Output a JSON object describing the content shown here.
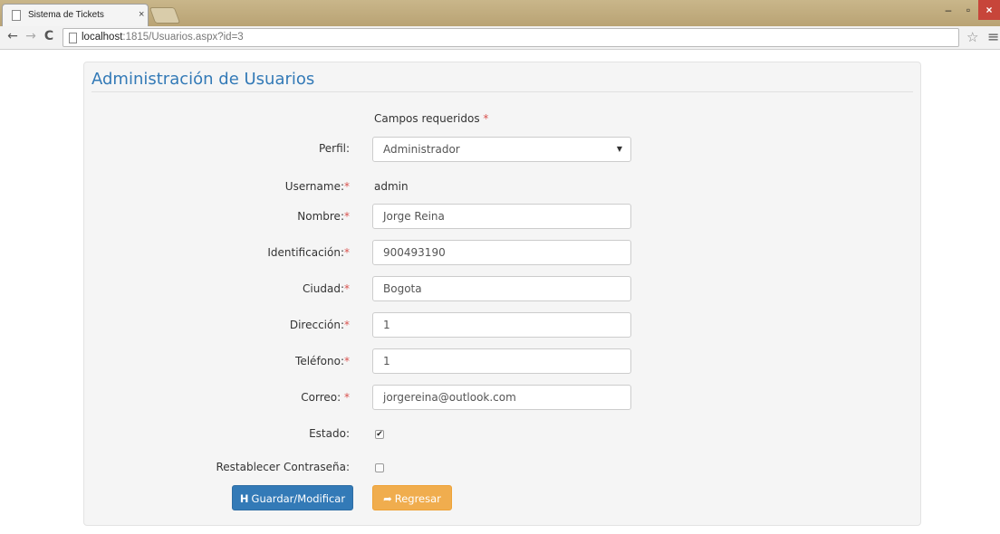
{
  "browser": {
    "tab_title": "Sistema de Tickets",
    "tab_close": "×",
    "url_host": "localhost",
    "url_path": ":1815/Usuarios.aspx?id=3",
    "minimize": "–",
    "maximize": "▫",
    "close": "×",
    "back": "←",
    "forward": "→",
    "reload": "C",
    "bookmark": "☆",
    "menu": "≡"
  },
  "page": {
    "title": "Administración de Usuarios",
    "required_text": "Campos requeridos",
    "required_star": "*"
  },
  "form": {
    "perfil": {
      "label": "Perfil:",
      "value": "Administrador"
    },
    "username": {
      "label": "Username:",
      "star": "*",
      "value": "admin"
    },
    "nombre": {
      "label": "Nombre:",
      "star": "*",
      "value": "Jorge Reina"
    },
    "identificacion": {
      "label": "Identificación:",
      "star": "*",
      "value": "900493190"
    },
    "ciudad": {
      "label": "Ciudad:",
      "star": "*",
      "value": "Bogota"
    },
    "direccion": {
      "label": "Dirección:",
      "star": "*",
      "value": "1"
    },
    "telefono": {
      "label": "Teléfono:",
      "star": "*",
      "value": "1"
    },
    "correo": {
      "label": "Correo:",
      "star": "*",
      "value": "jorgereina@outlook.com"
    },
    "estado": {
      "label": "Estado:",
      "checked": true,
      "mark": "✔"
    },
    "reset_password": {
      "label": "Restablecer Contraseña:",
      "checked": false,
      "mark": ""
    }
  },
  "buttons": {
    "save_icon": "H",
    "save": "Guardar/Modificar",
    "back_icon": "➦",
    "back": "Regresar"
  },
  "colors": {
    "primary": "#337ab7",
    "warning": "#f0ad4e",
    "required": "#d9534f"
  }
}
